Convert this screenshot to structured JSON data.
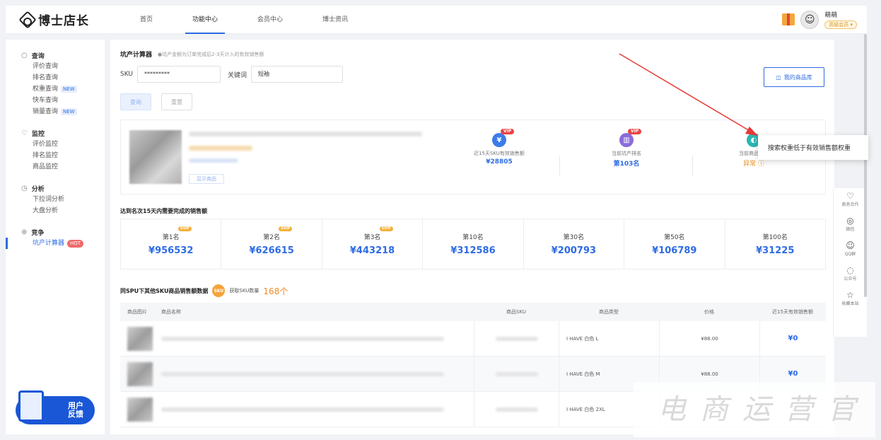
{
  "header": {
    "logo_text": "博士店长",
    "nav": [
      "首页",
      "功能中心",
      "会员中心",
      "博士资讯"
    ],
    "active_nav": "功能中心",
    "user_name": "萌萌",
    "user_badge": "高级会员 ▾"
  },
  "sidebar": {
    "groups": [
      {
        "title": "查询",
        "icon": "search-icon",
        "items": [
          {
            "label": "评价查询",
            "tag": ""
          },
          {
            "label": "排名查询",
            "tag": ""
          },
          {
            "label": "权重查询",
            "tag": "NEW"
          },
          {
            "label": "快车查询",
            "tag": ""
          },
          {
            "label": "销量查询",
            "tag": "NEW"
          }
        ]
      },
      {
        "title": "监控",
        "icon": "monitor-icon",
        "items": [
          {
            "label": "评价监控",
            "tag": ""
          },
          {
            "label": "排名监控",
            "tag": ""
          },
          {
            "label": "商品监控",
            "tag": ""
          }
        ]
      },
      {
        "title": "分析",
        "icon": "clock-icon",
        "items": [
          {
            "label": "下拉词分析",
            "tag": ""
          },
          {
            "label": "大盘分析",
            "tag": ""
          }
        ]
      },
      {
        "title": "竞争",
        "icon": "compete-icon",
        "items": [
          {
            "label": "坑产计算器",
            "tag": "HOT"
          }
        ]
      }
    ],
    "feedback": {
      "line1": "用户",
      "line2": "反馈"
    }
  },
  "main": {
    "title": "坑产计算器",
    "note": "●坑产金额为订单完成后2-3天计入的有效销售额",
    "sku_label": "SKU",
    "sku_value": "*********",
    "keyword_label": "关键词",
    "keyword_value": "短袖",
    "query_btn": "查询",
    "reset_btn": "重置",
    "library_btn": "我的商品库",
    "product_btn": "显示商品",
    "stats": [
      {
        "icon": "yen-icon",
        "label": "近15天SKU有效销售额",
        "value": "¥28805",
        "badge": "VIP"
      },
      {
        "icon": "rank-icon",
        "label": "当前坑产排名",
        "value": "第103名",
        "badge": "VIP"
      },
      {
        "icon": "status-icon",
        "label": "当前商品状态",
        "value": "异常 ⓘ",
        "badge": ""
      }
    ],
    "rank_title": "达到名次15天内需要完成的销售额",
    "ranks": [
      {
        "label": "第1名",
        "value": "¥956532",
        "svip": "SVIP"
      },
      {
        "label": "第2名",
        "value": "¥626615",
        "svip": "SVIP"
      },
      {
        "label": "第3名",
        "value": "¥443218",
        "svip": "SVIP"
      },
      {
        "label": "第10名",
        "value": "¥312586",
        "svip": ""
      },
      {
        "label": "第30名",
        "value": "¥200793",
        "svip": ""
      },
      {
        "label": "第50名",
        "value": "¥106789",
        "svip": ""
      },
      {
        "label": "第100名",
        "value": "¥31225",
        "svip": ""
      }
    ],
    "spu_title": "同SPU下其他SKU商品销售额数据",
    "sku_count_label": "获取SKU数量",
    "sku_count": "168个",
    "sku_icon_text": "SKU",
    "table_headers": [
      "商品图片",
      "商品名称",
      "商品SKU",
      "商品类型",
      "价格",
      "近15天有效销售额"
    ],
    "rows": [
      {
        "type": "I HAVE 白色  L",
        "price": "¥88.00",
        "sales": "¥0"
      },
      {
        "type": "I HAVE 白色  M",
        "price": "¥88.00",
        "sales": "¥0"
      },
      {
        "type": "I HAVE 白色  2XL",
        "price": "",
        "sales": ""
      }
    ]
  },
  "tooltip": "搜索权重低于有效销售额权重",
  "float_panel": [
    {
      "icon": "handshake-icon",
      "glyph": "♡",
      "label": "商务合作"
    },
    {
      "icon": "wechat-icon",
      "glyph": "◎",
      "label": "微信"
    },
    {
      "icon": "qq-icon",
      "glyph": "☺",
      "label": "QQ群"
    },
    {
      "icon": "official-account-icon",
      "glyph": "◌",
      "label": "公众号"
    },
    {
      "icon": "star-icon",
      "glyph": "☆",
      "label": "收藏本站"
    }
  ],
  "watermark": "电商运营官",
  "colors": {
    "accent": "#2d6be4",
    "warning": "#e38b1a",
    "hot": "#f06a6a",
    "arrow": "#e53935"
  }
}
